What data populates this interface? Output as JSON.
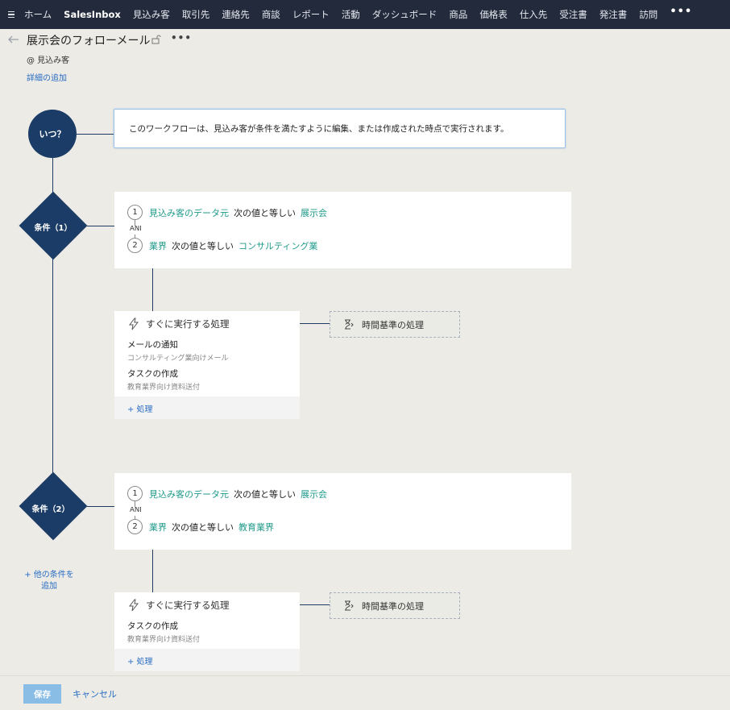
{
  "nav": {
    "items": [
      {
        "label": "ホーム",
        "bold": false
      },
      {
        "label": "SalesInbox",
        "bold": true
      },
      {
        "label": "見込み客",
        "bold": false
      },
      {
        "label": "取引先",
        "bold": false
      },
      {
        "label": "連絡先",
        "bold": false
      },
      {
        "label": "商談",
        "bold": false
      },
      {
        "label": "レポート",
        "bold": false
      },
      {
        "label": "活動",
        "bold": false
      },
      {
        "label": "ダッシュボード",
        "bold": false
      },
      {
        "label": "商品",
        "bold": false
      },
      {
        "label": "価格表",
        "bold": false
      },
      {
        "label": "仕入先",
        "bold": false
      },
      {
        "label": "受注書",
        "bold": false
      },
      {
        "label": "発注書",
        "bold": false
      },
      {
        "label": "訪問",
        "bold": false
      }
    ],
    "more": "•••"
  },
  "header": {
    "title": "展示会のフォローメール",
    "more": "•••",
    "module": "@ 見込み客",
    "add_details": "詳細の追加"
  },
  "trigger": {
    "node_label": "いつ？",
    "description": "このワークフローは、見込み客が条件を満たすように編集、または作成された時点で実行されます。"
  },
  "conditions": [
    {
      "node_label": "条件（1）",
      "rows": [
        {
          "num": "1",
          "field": "見込み客のデータ元",
          "operator": "次の値と等しい",
          "value": "展示会"
        },
        {
          "num": "2",
          "field": "業界",
          "operator": "次の値と等しい",
          "value": "コンサルティング業"
        }
      ],
      "and_label": "AND",
      "action": {
        "heading": "すぐに実行する処理",
        "items": [
          {
            "title": "メールの通知",
            "subtitle": "コンサルティング業向けメール"
          },
          {
            "title": "タスクの作成",
            "subtitle": "教育業界向け資料送付"
          }
        ],
        "add_label": "+ 処理"
      },
      "time_based": "時間基準の処理"
    },
    {
      "node_label": "条件（2）",
      "rows": [
        {
          "num": "1",
          "field": "見込み客のデータ元",
          "operator": "次の値と等しい",
          "value": "展示会"
        },
        {
          "num": "2",
          "field": "業界",
          "operator": "次の値と等しい",
          "value": "教育業界"
        }
      ],
      "and_label": "AND",
      "action": {
        "heading": "すぐに実行する処理",
        "items": [
          {
            "title": "タスクの作成",
            "subtitle": "教育業界向け資料送付"
          }
        ],
        "add_label": "+ 処理"
      },
      "time_based": "時間基準の処理"
    }
  ],
  "add_condition": "+ 他の条件を追加",
  "footer": {
    "save_label": "保存",
    "cancel_label": "キャンセル"
  },
  "colors": {
    "nav_bg": "#232a3b",
    "node": "#1b3c67",
    "field_text": "#1f9a8a",
    "link": "#2a6dc4",
    "save_button": "#89bde6"
  }
}
